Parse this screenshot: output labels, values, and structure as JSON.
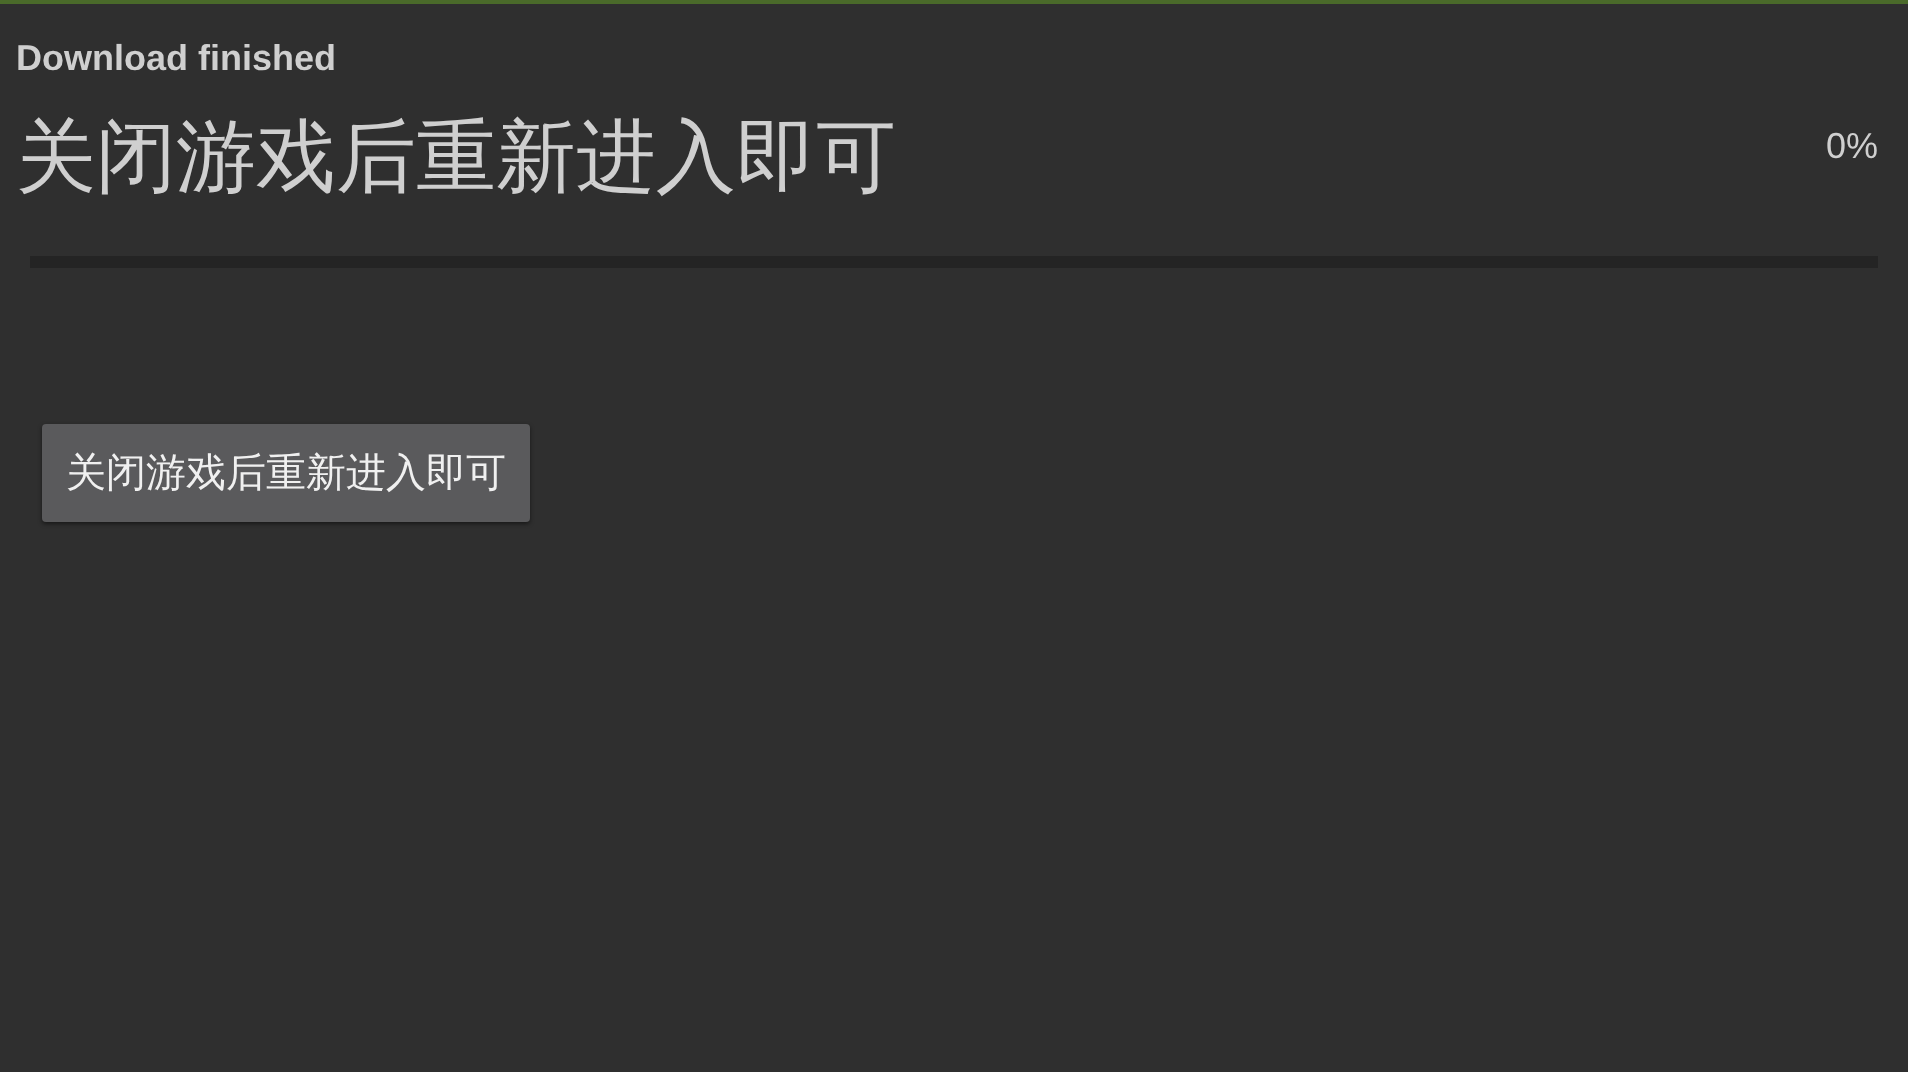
{
  "title": "Download finished",
  "message": "关闭游戏后重新进入即可",
  "progress": {
    "reading": "0%"
  },
  "buttons": [
    "关闭游戏后重新进入即可"
  ]
}
